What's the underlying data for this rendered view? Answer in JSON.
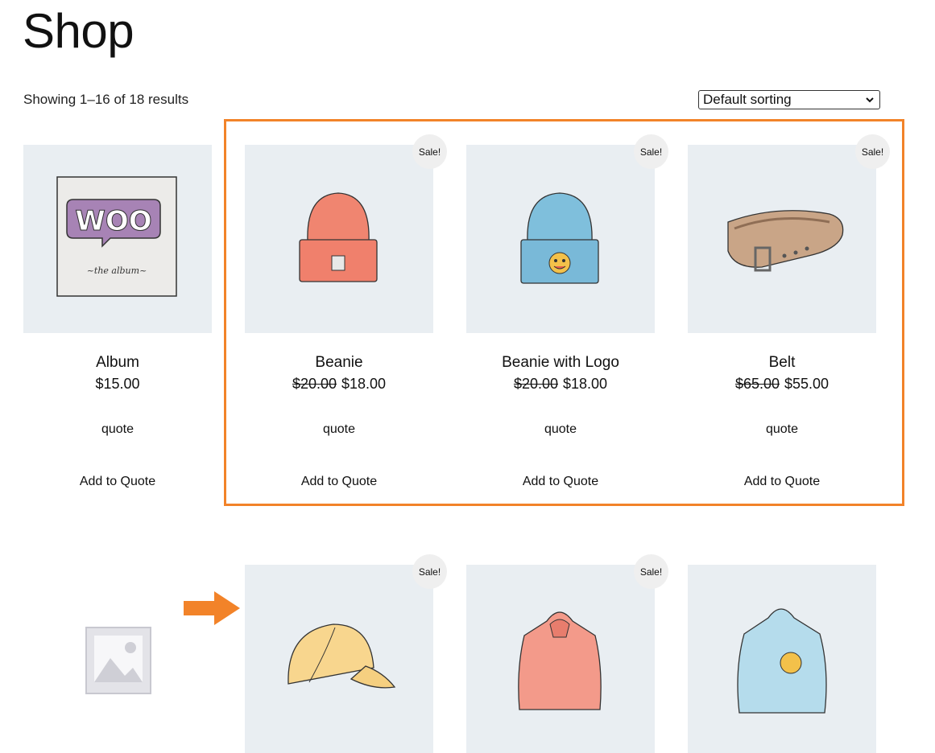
{
  "page": {
    "title": "Shop"
  },
  "toolbar": {
    "result_count": "Showing 1–16 of 18 results",
    "sorting_selected": "Default sorting"
  },
  "products": [
    {
      "name": "Album",
      "price": "$15.00",
      "regular_price": "",
      "sale": false,
      "sale_label": "",
      "quote": "quote",
      "add_label": "Add to Quote",
      "image": "woo-album-icon"
    },
    {
      "name": "Beanie",
      "price": "$18.00",
      "regular_price": "$20.00",
      "sale": true,
      "sale_label": "Sale!",
      "quote": "quote",
      "add_label": "Add to Quote",
      "image": "beanie-icon"
    },
    {
      "name": "Beanie with Logo",
      "price": "$18.00",
      "regular_price": "$20.00",
      "sale": true,
      "sale_label": "Sale!",
      "quote": "quote",
      "add_label": "Add to Quote",
      "image": "beanie-logo-icon"
    },
    {
      "name": "Belt",
      "price": "$55.00",
      "regular_price": "$65.00",
      "sale": true,
      "sale_label": "Sale!",
      "quote": "quote",
      "add_label": "Add to Quote",
      "image": "belt-icon"
    },
    {
      "name": "",
      "sale": false,
      "sale_label": "",
      "image": "placeholder-image-icon"
    },
    {
      "name": "",
      "sale": true,
      "sale_label": "Sale!",
      "image": "cap-icon"
    },
    {
      "name": "",
      "sale": true,
      "sale_label": "Sale!",
      "image": "hoodie-icon"
    },
    {
      "name": "",
      "sale": false,
      "sale_label": "",
      "image": "hoodie-logo-icon"
    }
  ],
  "colors": {
    "highlight": "#f28329",
    "arrow": "#f28329",
    "image_bg": "#e9eef2"
  }
}
